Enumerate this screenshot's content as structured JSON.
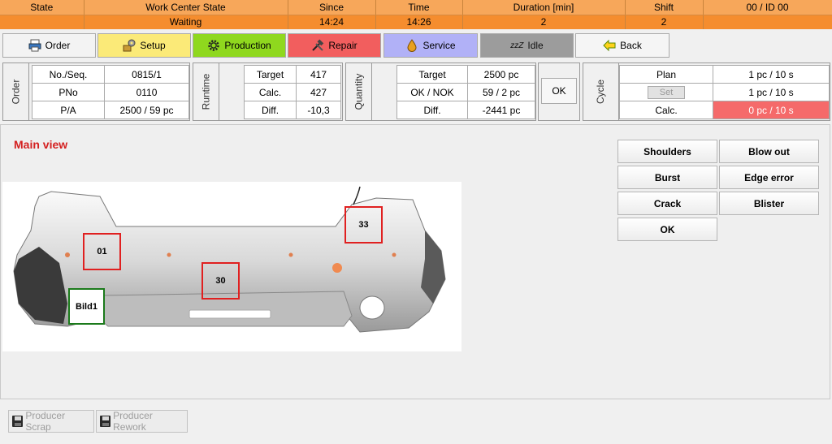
{
  "status": {
    "headers": [
      "State",
      "Work Center State",
      "Since",
      "Time",
      "Duration [min]",
      "Shift",
      "00  / ID 00"
    ],
    "values": [
      "",
      "Waiting",
      "14:24",
      "14:26",
      "2",
      "2",
      ""
    ]
  },
  "toolbar": {
    "order": "Order",
    "setup": "Setup",
    "production": "Production",
    "repair": "Repair",
    "service": "Service",
    "idle": "Idle",
    "idle_glyph": "zzZ",
    "back": "Back"
  },
  "colors": {
    "header_orange": "#f7a75a",
    "value_orange": "#f58d2e",
    "setup": "#fbea78",
    "production": "#8fd81e",
    "repair": "#f25e5e",
    "service": "#b1b1f7",
    "idle": "#9c9c9c",
    "alert_red": "#f56a6a"
  },
  "order": {
    "label": "Order",
    "rows": [
      {
        "k": "No./Seq.",
        "v": "0815/1"
      },
      {
        "k": "PNo",
        "v": "0110"
      },
      {
        "k": "P/A",
        "v": "2500  / 59 pc"
      }
    ]
  },
  "runtime": {
    "label": "Runtime",
    "rows": [
      {
        "k": "Target",
        "v": "417"
      },
      {
        "k": "Calc.",
        "v": "427"
      },
      {
        "k": "Diff.",
        "v": "-10,3"
      }
    ]
  },
  "quantity": {
    "label": "Quantity",
    "rows": [
      {
        "k": "Target",
        "v": "2500 pc"
      },
      {
        "k": "OK / NOK",
        "v": "59  / 2 pc"
      },
      {
        "k": "Diff.",
        "v": "-2441 pc"
      }
    ],
    "ok_button": "OK"
  },
  "cycle": {
    "label": "Cycle",
    "plan_label": "Plan",
    "plan_value": "1 pc  / 10 s",
    "set_button": "Set",
    "set_value": "1 pc  / 10 s",
    "calc_label": "Calc.",
    "calc_value": "0  pc  / 10 s"
  },
  "main": {
    "title": "Main view",
    "markers": [
      "01",
      "30",
      "33",
      "Bild1"
    ],
    "defects": [
      "Shoulders",
      "Blow out",
      "Burst",
      "Edge error",
      "Crack",
      "Blister",
      "OK"
    ]
  },
  "bottom": {
    "scrap": "Producer Scrap",
    "rework": "Producer Rework"
  }
}
